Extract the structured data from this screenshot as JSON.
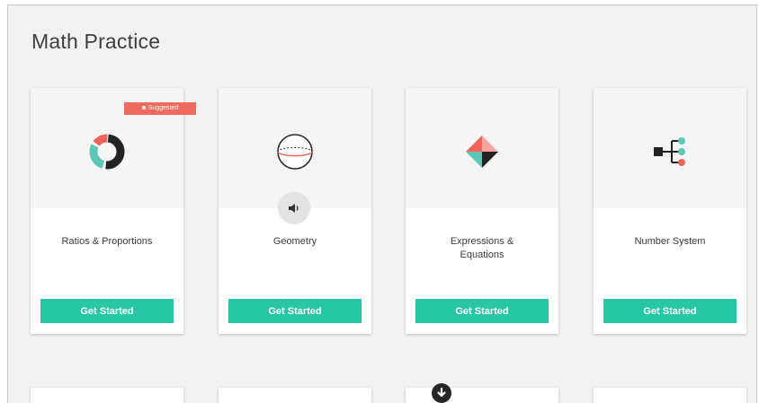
{
  "page": {
    "title": "Math Practice"
  },
  "cards": [
    {
      "title": "Ratios & Proportions",
      "button_label": "Get Started",
      "badge": "Suggested",
      "icon": "donut-chart-icon"
    },
    {
      "title": "Geometry",
      "button_label": "Get Started",
      "icon": "sphere-icon",
      "audio_icon": "speaker-icon"
    },
    {
      "title": "Expressions &\nEquations",
      "button_label": "Get Started",
      "icon": "diamond-shapes-icon"
    },
    {
      "title": "Number System",
      "button_label": "Get Started",
      "icon": "tree-diagram-icon"
    }
  ],
  "scroll_down_icon": "arrow-down-circle-icon",
  "colors": {
    "accent": "#27c6a4",
    "badge": "#ef6b5e",
    "teal": "#5dc6b5",
    "coral": "#f2645a",
    "dark": "#232323"
  }
}
